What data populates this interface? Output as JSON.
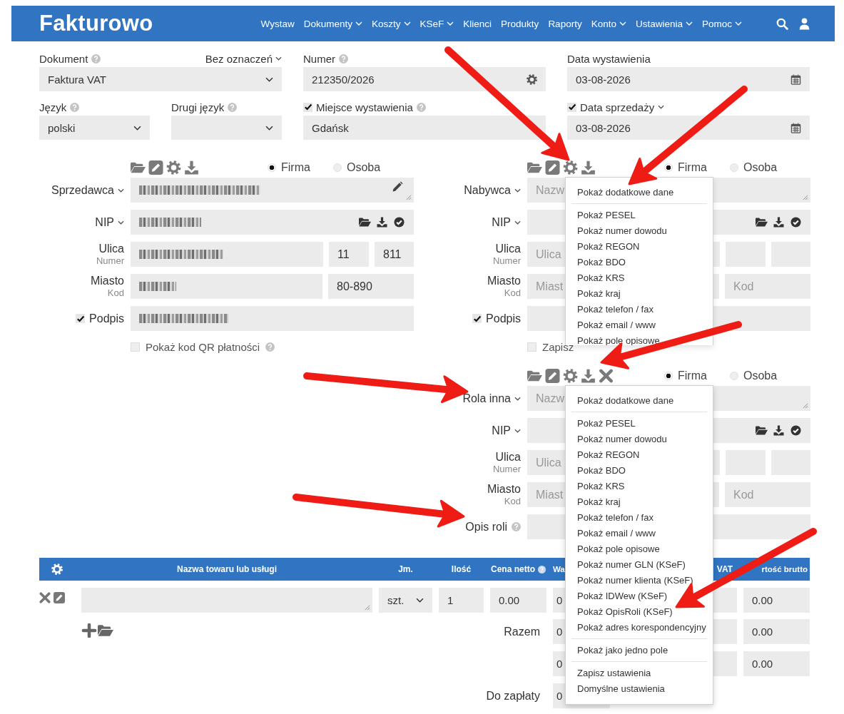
{
  "header": {
    "logo": "Fakturowo",
    "nav": [
      {
        "label": "Wystaw",
        "dropdown": false
      },
      {
        "label": "Dokumenty",
        "dropdown": true
      },
      {
        "label": "Koszty",
        "dropdown": true
      },
      {
        "label": "KSeF",
        "dropdown": true
      },
      {
        "label": "Klienci",
        "dropdown": false
      },
      {
        "label": "Produkty",
        "dropdown": false
      },
      {
        "label": "Raporty",
        "dropdown": false
      },
      {
        "label": "Konto",
        "dropdown": true
      },
      {
        "label": "Ustawienia",
        "dropdown": true
      },
      {
        "label": "Pomoc",
        "dropdown": true
      }
    ]
  },
  "top_fields": [
    {
      "label": "Dokument",
      "help": true,
      "dropdown": false,
      "aside": "Bez oznaczeń",
      "kind": "select",
      "value": "Faktura VAT",
      "narrow": false
    },
    {
      "label": "Numer",
      "help": true,
      "dropdown": false,
      "kind": "gear",
      "value": "212350/2026",
      "narrow": false
    },
    {
      "label": "Data wystawienia",
      "help": false,
      "dropdown": false,
      "kind": "date",
      "value": "03-08-2026",
      "narrow": false
    },
    {
      "label": "Język",
      "help": true,
      "dropdown": false,
      "kind": "select",
      "value": "polski",
      "narrow": true
    },
    {
      "label": "Drugi język",
      "help": true,
      "dropdown": false,
      "kind": "select",
      "narrow": true
    },
    {
      "label": "Miejsce wystawienia",
      "help": true,
      "dropdown": false,
      "checked": true,
      "kind": "text",
      "value": "Gdańsk",
      "narrow": false
    },
    {
      "label": "Data sprzedaży",
      "help": false,
      "dropdown": true,
      "checked": true,
      "kind": "date",
      "value": "03-08-2026",
      "narrow": false
    }
  ],
  "parties": [
    {
      "removable": false,
      "entity": [
        {
          "label": "Firma",
          "selected": true
        },
        {
          "label": "Osoba",
          "selected": false
        }
      ],
      "rows": [
        {
          "kind": "name",
          "label": "Sprzedawca",
          "dropdown": true,
          "help": false,
          "edit_icon": true,
          "fields": [
            {
              "redacted": true
            }
          ]
        },
        {
          "kind": "nip",
          "label": "NIP",
          "dropdown": true,
          "help": false,
          "fields": [
            {
              "redacted": true
            }
          ]
        },
        {
          "kind": "address",
          "label": "Ulica",
          "sublabel": "Numer",
          "dropdown": false,
          "help": false,
          "fields": [
            {
              "redacted": true
            },
            {
              "redacted": false,
              "value": "11"
            },
            {
              "redacted": false,
              "value": "811"
            }
          ]
        },
        {
          "kind": "city",
          "label": "Miasto",
          "sublabel": "Kod",
          "dropdown": false,
          "help": false,
          "fields": [
            {
              "redacted": true
            },
            {
              "redacted": false,
              "value": "80-890"
            }
          ]
        },
        {
          "kind": "text",
          "label": "Podpis",
          "checked": true,
          "dropdown": false,
          "help": false,
          "fields": [
            {
              "redacted": true
            }
          ]
        }
      ],
      "footer": {
        "label": "Pokaż kod QR płatności",
        "checked": false,
        "help": true
      }
    },
    {
      "removable": false,
      "entity": [
        {
          "label": "Firma",
          "selected": true
        },
        {
          "label": "Osoba",
          "selected": false
        }
      ],
      "rows": [
        {
          "kind": "name",
          "label": "Nabywca",
          "dropdown": true,
          "help": false,
          "edit_icon": false,
          "fields": [
            {
              "redacted": false,
              "placeholder": "Nazw"
            }
          ]
        },
        {
          "kind": "nip",
          "label": "NIP",
          "dropdown": true,
          "help": false,
          "fields": [
            {
              "redacted": false
            }
          ]
        },
        {
          "kind": "address",
          "label": "Ulica",
          "sublabel": "Numer",
          "dropdown": false,
          "help": false,
          "fields": [
            {
              "redacted": false,
              "placeholder": "Ulica"
            },
            {
              "redacted": false
            },
            {
              "redacted": false
            }
          ]
        },
        {
          "kind": "city",
          "label": "Miasto",
          "sublabel": "Kod",
          "dropdown": false,
          "help": false,
          "fields": [
            {
              "redacted": false,
              "placeholder": "Miast"
            },
            {
              "redacted": false,
              "placeholder": "Kod"
            }
          ]
        },
        {
          "kind": "text",
          "label": "Podpis",
          "checked": true,
          "dropdown": false,
          "help": false,
          "fields": [
            {
              "redacted": false
            }
          ]
        }
      ],
      "footer": {
        "label": "Zapisz",
        "checked": false,
        "help": false
      },
      "menu": {
        "groups": [
          [
            "Pokaż dodatkowe dane"
          ],
          [
            "Pokaż PESEL",
            "Pokaż numer dowodu",
            "Pokaż REGON",
            "Pokaż BDO",
            "Pokaż KRS",
            "Pokaż kraj",
            "Pokaż telefon / fax",
            "Pokaż email / www",
            "Pokaż pole opisowe"
          ]
        ]
      }
    },
    {
      "removable": true,
      "entity": [
        {
          "label": "Firma",
          "selected": true
        },
        {
          "label": "Osoba",
          "selected": false
        }
      ],
      "rows": [
        {
          "kind": "name",
          "label": "Rola inna",
          "dropdown": true,
          "help": false,
          "edit_icon": false,
          "fields": [
            {
              "redacted": false,
              "placeholder": "Nazw"
            }
          ]
        },
        {
          "kind": "nip",
          "label": "NIP",
          "dropdown": true,
          "help": false,
          "fields": [
            {
              "redacted": false
            }
          ]
        },
        {
          "kind": "address",
          "label": "Ulica",
          "sublabel": "Numer",
          "dropdown": false,
          "help": false,
          "fields": [
            {
              "redacted": false,
              "placeholder": "Ulica"
            },
            {
              "redacted": false
            },
            {
              "redacted": false
            }
          ]
        },
        {
          "kind": "city",
          "label": "Miasto",
          "sublabel": "Kod",
          "dropdown": false,
          "help": false,
          "fields": [
            {
              "redacted": false,
              "placeholder": "Miast"
            },
            {
              "redacted": false,
              "placeholder": "Kod"
            }
          ]
        },
        {
          "kind": "text",
          "label": "Opis roli",
          "dropdown": false,
          "help": true,
          "fields": [
            {
              "redacted": false
            }
          ]
        }
      ],
      "menu": {
        "groups": [
          [
            "Pokaż dodatkowe dane"
          ],
          [
            "Pokaż PESEL",
            "Pokaż numer dowodu",
            "Pokaż REGON",
            "Pokaż BDO",
            "Pokaż KRS",
            "Pokaż kraj",
            "Pokaż telefon / fax",
            "Pokaż email / www",
            "Pokaż pole opisowe",
            "Pokaż numer GLN (KSeF)",
            "Pokaż numer klienta (KSeF)",
            "Pokaż IDWew (KSeF)",
            "Pokaż OpisRoli (KSeF)",
            "Pokaż adres korespondencyjny"
          ],
          [
            "Pokaż jako jedno pole"
          ],
          [
            "Zapisz ustawienia",
            "Domyślne ustawienia"
          ]
        ]
      }
    }
  ],
  "items_table": {
    "columns": [
      {
        "kind": "settings"
      },
      {
        "label": "Nazwa towaru lub usługi",
        "help": false
      },
      {
        "label": "Jm.",
        "help": false
      },
      {
        "label": "Ilość",
        "help": false
      },
      {
        "label": "Cena netto",
        "help": true
      },
      {
        "label": "Wa",
        "help": false
      },
      {
        "label": "VAT",
        "help": false
      },
      {
        "label": "rtość brutto",
        "help": false
      }
    ],
    "rows": [
      {
        "unit": "szt.",
        "quantity": "1",
        "net_price": "0.00",
        "net_value": "0",
        "gross_value": "0.00"
      }
    ],
    "totals": [
      {
        "label": "Razem",
        "net": "0",
        "gross": "0.00"
      },
      {
        "net": "0",
        "gross": "0.00"
      },
      {
        "label": "Do zapłaty",
        "net": "0"
      }
    ]
  }
}
